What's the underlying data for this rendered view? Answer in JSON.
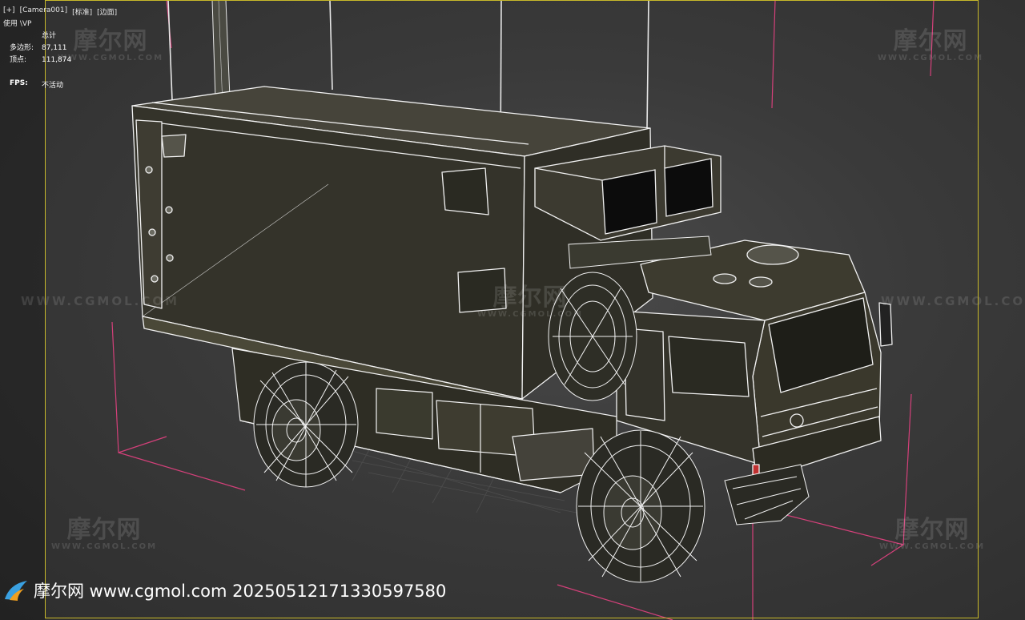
{
  "viewport": {
    "labels": [
      "[+]",
      "[Camera001]",
      "[标准]",
      "[边面]"
    ],
    "sublabel": "使用 \\VP"
  },
  "stats": {
    "title": "总计",
    "rows": [
      {
        "key": "多边形:",
        "value": "87,111"
      },
      {
        "key": "顶点:",
        "value": "111,874"
      }
    ],
    "fps_key": "FPS:",
    "fps_value": "不活动"
  },
  "watermark": {
    "cn": "摩尔网",
    "en": "WWW.CGMOL.COM",
    "line": "WWW.CGMOL.COM"
  },
  "caption": {
    "text": "摩尔网 www.cgmol.com 20250512171330597580"
  },
  "icons": {
    "logo": "cgmol-logo-icon"
  },
  "colors": {
    "safe_frame": "#c8b92a",
    "bbox": "#d4407a",
    "wire": "#f2f2f2",
    "truck_fill": "#3c3a2c"
  }
}
